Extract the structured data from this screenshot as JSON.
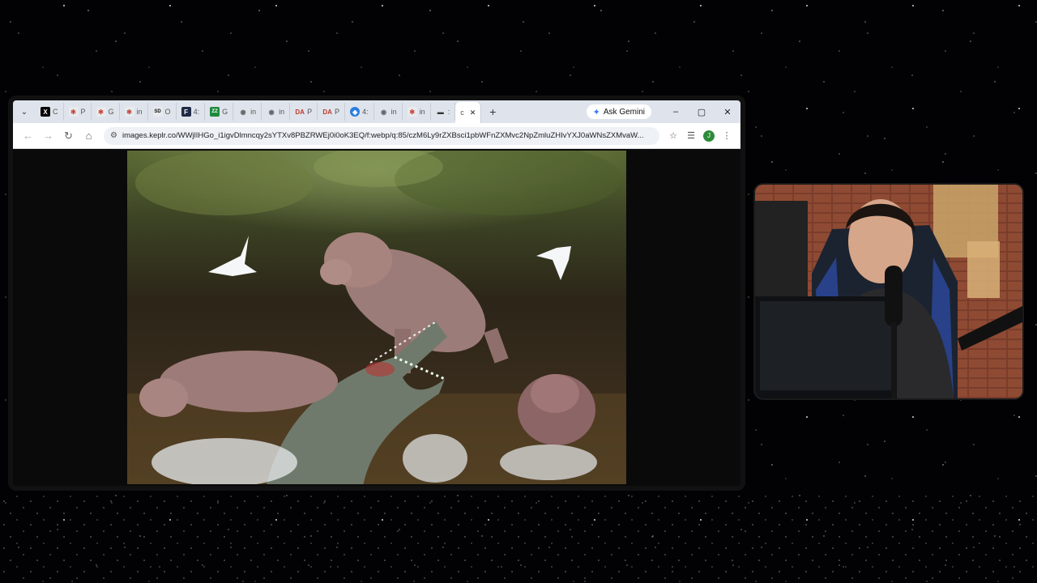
{
  "browser": {
    "tabs": [
      {
        "favicon": "x-logo",
        "icon_text": "X",
        "label": "C"
      },
      {
        "favicon": "tool-icon",
        "icon_text": "✻",
        "label": "P"
      },
      {
        "favicon": "tool-icon",
        "icon_text": "✻",
        "label": "G"
      },
      {
        "favicon": "tool-icon",
        "icon_text": "✻",
        "label": "in"
      },
      {
        "favicon": "page-icon",
        "icon_text": "SD",
        "label": "O"
      },
      {
        "favicon": "f-logo",
        "icon_text": "F",
        "label": "4:"
      },
      {
        "favicon": "green-logo",
        "icon_text": "ZZ",
        "label": "G"
      },
      {
        "favicon": "globe-icon",
        "icon_text": "◉",
        "label": "in"
      },
      {
        "favicon": "globe-icon",
        "icon_text": "◉",
        "label": "in"
      },
      {
        "favicon": "da-logo",
        "icon_text": "DA",
        "label": "P"
      },
      {
        "favicon": "da-logo",
        "icon_text": "DA",
        "label": "P"
      },
      {
        "favicon": "blue-logo",
        "icon_text": "◆",
        "label": "4:"
      },
      {
        "favicon": "globe-icon",
        "icon_text": "◉",
        "label": "in"
      },
      {
        "favicon": "tool-icon",
        "icon_text": "✻",
        "label": "in"
      },
      {
        "favicon": "bar-icon",
        "icon_text": "▬",
        "label": ":"
      }
    ],
    "active_tab": {
      "label": "c",
      "close": "✕"
    },
    "new_tab": "+",
    "gemini_label": "Ask Gemini",
    "window_controls": {
      "minimize": "–",
      "maximize": "▢",
      "close": "✕"
    },
    "nav": {
      "back": "←",
      "forward": "→",
      "reload": "↻",
      "home": "⌂"
    },
    "url": "images.keplr.co/WWjlIHGo_i1igvDlmncqy2sYTXv8PBZRWEj0i0oK3EQ/f:webp/q:85/czM6Ly9rZXBsci1pbWFnZXMvc2NpZmluZHIvYXJ0aWNsZXMvaW...",
    "profile_initial": "J",
    "menu_glyph": "⋮"
  },
  "colors": {
    "tabbar": "#dfe4ec",
    "accent_green": "#2e8b3a",
    "gemini_blue": "#3b7cf5"
  }
}
